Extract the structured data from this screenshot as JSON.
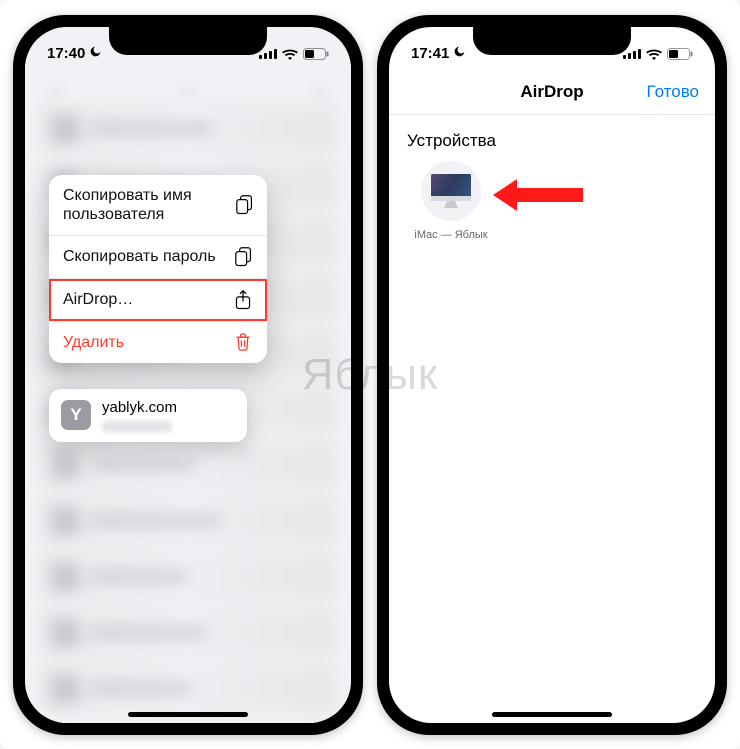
{
  "watermark": "Яблык",
  "status": {
    "time_left": "17:40",
    "time_right": "17:41"
  },
  "screen1": {
    "menu": {
      "copy_username": "Скопировать имя пользователя",
      "copy_password": "Скопировать пароль",
      "airdrop": "AirDrop…",
      "delete": "Удалить"
    },
    "preview": {
      "initial": "Y",
      "site": "yablyk.com"
    }
  },
  "screen2": {
    "nav_title": "AirDrop",
    "done": "Готово",
    "section": "Устройства",
    "device_name": "iMac — Яблык"
  }
}
